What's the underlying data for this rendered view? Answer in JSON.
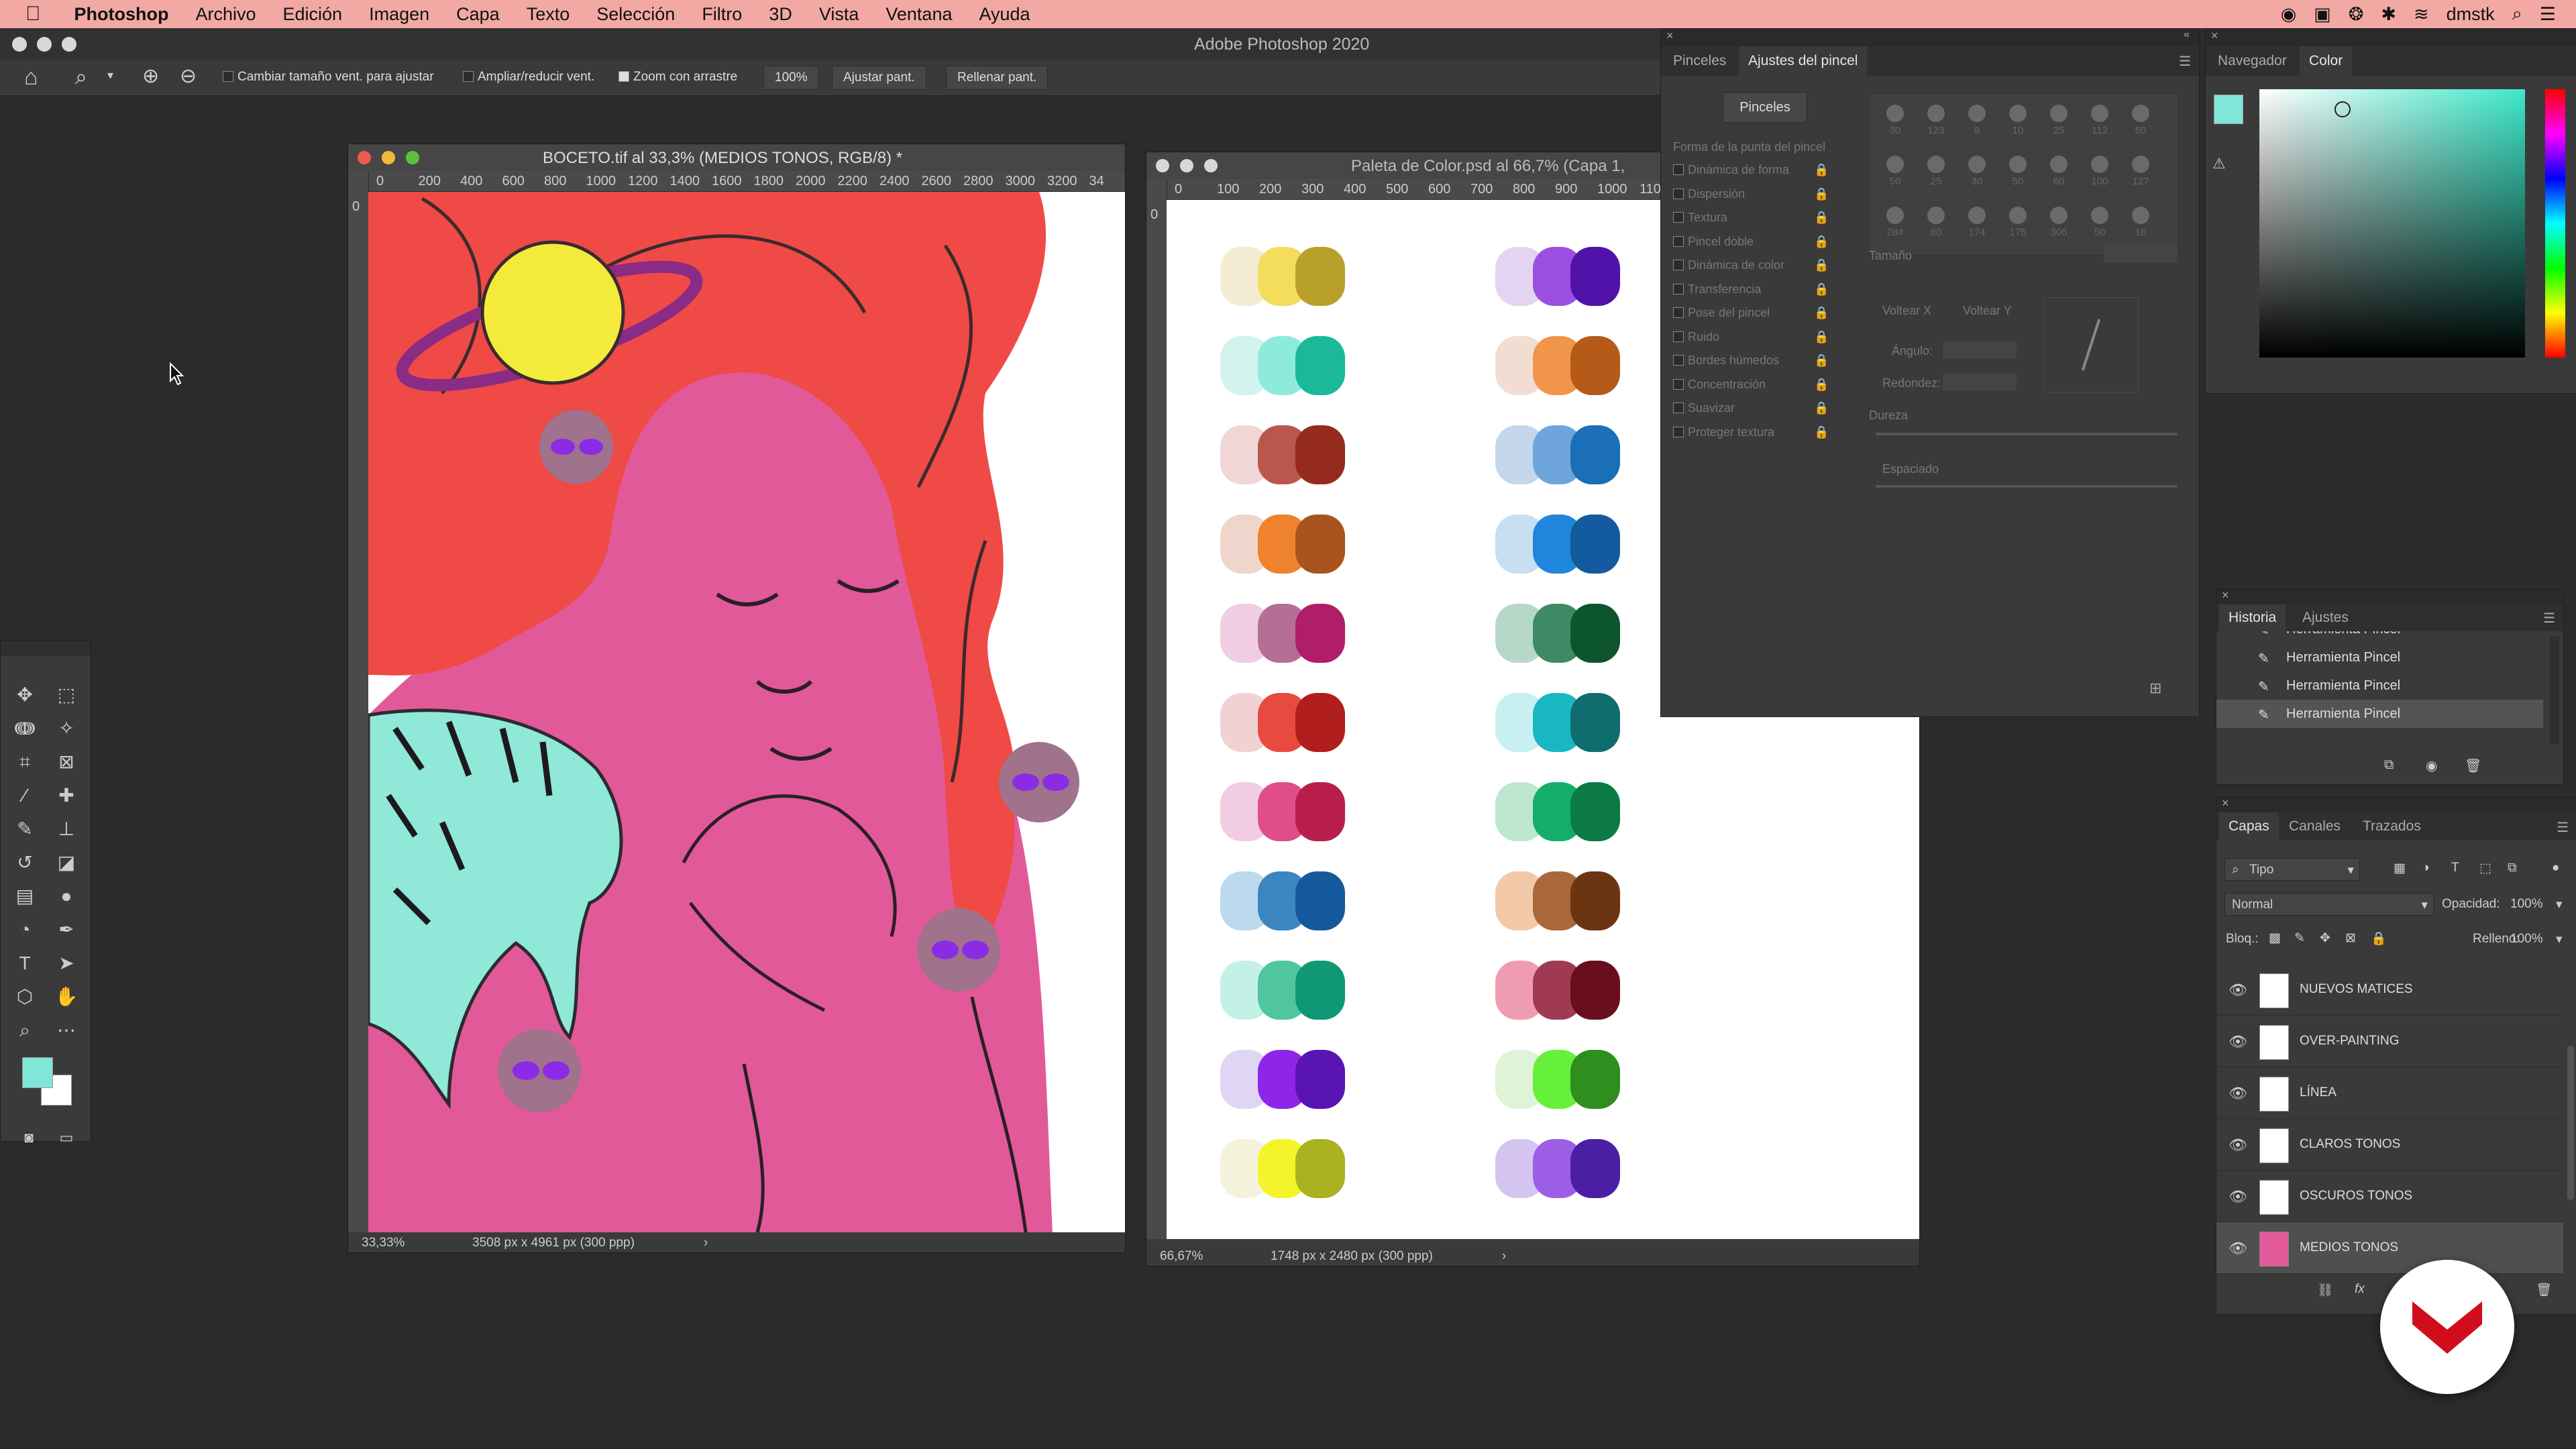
{
  "menubar": {
    "app": "Photoshop",
    "items": [
      "Archivo",
      "Edición",
      "Imagen",
      "Capa",
      "Texto",
      "Selección",
      "Filtro",
      "3D",
      "Vista",
      "Ventana",
      "Ayuda"
    ],
    "user": "dmstk"
  },
  "window": {
    "title": "Adobe Photoshop 2020"
  },
  "options": {
    "resize_windows": "Cambiar tamaño vent. para ajustar",
    "zoom_all": "Ampliar/reducir vent.",
    "scrubby_zoom": "Zoom con arrastre",
    "zoom_value": "100%",
    "fit_screen": "Ajustar pant.",
    "fill_screen": "Rellenar pant."
  },
  "doc1": {
    "title": "BOCETO.tif al 33,3% (MEDIOS TONOS, RGB/8) *",
    "zoom": "33,33%",
    "info": "3508 px x 4961 px (300 ppp)",
    "ruler_v0": "0",
    "ruler": [
      "0",
      "200",
      "400",
      "600",
      "800",
      "1000",
      "1200",
      "1400",
      "1600",
      "1800",
      "2000",
      "2200",
      "2400",
      "2600",
      "2800",
      "3000",
      "3200",
      "34"
    ]
  },
  "doc2": {
    "title": "Paleta de Color.psd al 66,7% (Capa 1,",
    "zoom": "66,67%",
    "info": "1748 px x 2480 px (300 ppp)",
    "ruler_v0": "0",
    "ruler": [
      "0",
      "100",
      "200",
      "300",
      "400",
      "500",
      "600",
      "700",
      "800",
      "900",
      "1000",
      "110"
    ]
  },
  "brush_panel": {
    "tabs": [
      "Pinceles",
      "Ajustes del pincel"
    ],
    "button": "Pinceles",
    "tip_shape": "Forma de la punta del pincel",
    "options": [
      "Dinámica de forma",
      "Dispersión",
      "Textura",
      "Pincel doble",
      "Dinámica de color",
      "Transferencia",
      "Pose del pincel",
      "Ruido",
      "Bordes húmedos",
      "Concentración",
      "Suavizar",
      "Proteger textura"
    ],
    "size_label": "Tamaño",
    "flip_x": "Voltear X",
    "flip_y": "Voltear Y",
    "angle": "Ángulo:",
    "roundness": "Redondez:",
    "hardness": "Dureza",
    "spacing": "Espaciado",
    "sizes": [
      "30",
      "123",
      "8",
      "10",
      "25",
      "112",
      "60",
      "50",
      "25",
      "30",
      "50",
      "60",
      "100",
      "127",
      "284",
      "80",
      "174",
      "175",
      "306",
      "50",
      "16"
    ]
  },
  "color_panel": {
    "tabs": [
      "Navegador",
      "Color"
    ]
  },
  "history_panel": {
    "tabs": [
      "Historia",
      "Ajustes"
    ],
    "items": [
      "Herramienta Pincel",
      "Herramienta Pincel",
      "Herramienta Pincel",
      "Herramienta Pincel"
    ]
  },
  "layers_panel": {
    "tabs": [
      "Capas",
      "Canales",
      "Trazados"
    ],
    "filter": "Tipo",
    "blend_mode": "Normal",
    "opacity_label": "Opacidad:",
    "opacity": "100%",
    "lock_label": "Bloq.:",
    "fill_label": "Relleno:",
    "fill": "100%",
    "layers": [
      "NUEVOS MATICES",
      "OVER-PAINTING",
      "LÍNEA",
      "CLAROS TONOS",
      "OSCUROS TONOS",
      "MEDIOS TONOS"
    ]
  },
  "palette": {
    "left": [
      [
        "#f3ecd3",
        "#f3dd5a",
        "#b9a02a"
      ],
      [
        "#d3f4ee",
        "#8eebdc",
        "#1cb89a"
      ],
      [
        "#f0d6d4",
        "#b9574d",
        "#952a1f"
      ],
      [
        "#efd6cc",
        "#f0822d",
        "#a9531d"
      ],
      [
        "#f0cde2",
        "#b56f94",
        "#b01e6a"
      ],
      [
        "#f2d1d2",
        "#e84a40",
        "#b01e1e"
      ],
      [
        "#f2cce0",
        "#e04d8a",
        "#b81e4c"
      ],
      [
        "#bcd9ee",
        "#3c86c0",
        "#13599c"
      ],
      [
        "#c4f1e6",
        "#4fc5a0",
        "#0f9876"
      ],
      [
        "#e0d6f3",
        "#8d26e8",
        "#5a14b4"
      ],
      [
        "#f3f3dc",
        "#f4f42a",
        "#aab221"
      ]
    ],
    "right": [
      [
        "#e3d4f2",
        "#9b4ee0",
        "#5012a8"
      ],
      [
        "#f2ddd3",
        "#f0954a",
        "#b65a1a"
      ],
      [
        "#c4d6ea",
        "#6ea6dc",
        "#1a6fb7"
      ],
      [
        "#c7dff0",
        "#1f86dc",
        "#135a9e"
      ],
      [
        "#b6d8c8",
        "#3e8a64",
        "#0c552e"
      ],
      [
        "#c9f0f1",
        "#18b7c2",
        "#0f6d6f"
      ],
      [
        "#bde6d0",
        "#14ae6b",
        "#0b7a43"
      ],
      [
        "#f2c9a8",
        "#a8683c",
        "#6c3512"
      ],
      [
        "#ef9cb2",
        "#a03a52",
        "#6a0e1e"
      ],
      [
        "#dff3d6",
        "#66f03b",
        "#2e8e1e"
      ],
      [
        "#d4c4f0",
        "#9d5ee6",
        "#4a1fa4"
      ]
    ]
  },
  "colors": {
    "foreground": "#80e6d8",
    "background": "#ffffff",
    "picker_hue": "#3ee8c9"
  }
}
